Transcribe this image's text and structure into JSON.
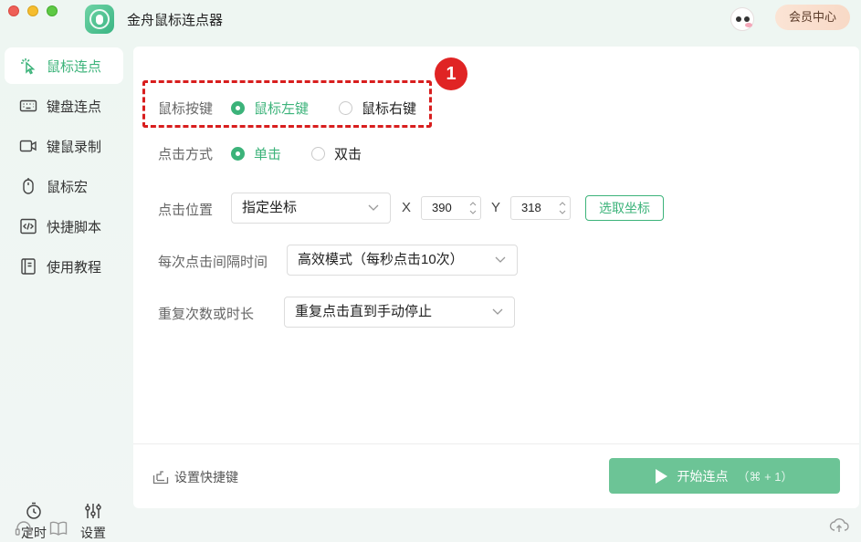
{
  "app": {
    "title": "金舟鼠标连点器",
    "vip_label": "会员中心"
  },
  "colors": {
    "accent": "#3cb37a",
    "annotation": "#e02424"
  },
  "sidebar": {
    "items": [
      {
        "label": "鼠标连点",
        "icon": "mouse-click-icon",
        "active": true
      },
      {
        "label": "键盘连点",
        "icon": "keyboard-icon",
        "active": false
      },
      {
        "label": "键鼠录制",
        "icon": "video-record-icon",
        "active": false
      },
      {
        "label": "鼠标宏",
        "icon": "mouse-icon",
        "active": false
      },
      {
        "label": "快捷脚本",
        "icon": "code-script-icon",
        "active": false
      },
      {
        "label": "使用教程",
        "icon": "book-icon",
        "active": false
      }
    ],
    "tools": [
      {
        "label": "定时",
        "icon": "timer-icon"
      },
      {
        "label": "设置",
        "icon": "sliders-icon"
      }
    ]
  },
  "annotation": {
    "badge": "1"
  },
  "form": {
    "mouse_button": {
      "label": "鼠标按键",
      "options": [
        "鼠标左键",
        "鼠标右键"
      ],
      "selected": "鼠标左键"
    },
    "click_type": {
      "label": "点击方式",
      "options": [
        "单击",
        "双击"
      ],
      "selected": "单击"
    },
    "position": {
      "label": "点击位置",
      "mode": "指定坐标",
      "x_label": "X",
      "x": "390",
      "y_label": "Y",
      "y": "318",
      "pick_label": "选取坐标"
    },
    "interval": {
      "label": "每次点击间隔时间",
      "value": "高效模式（每秒点击10次）"
    },
    "repeat": {
      "label": "重复次数或时长",
      "value": "重复点击直到手动停止"
    }
  },
  "footer": {
    "hotkey_label": "设置快捷键",
    "start_label": "开始连点",
    "start_shortcut": "（⌘ + 1）"
  }
}
